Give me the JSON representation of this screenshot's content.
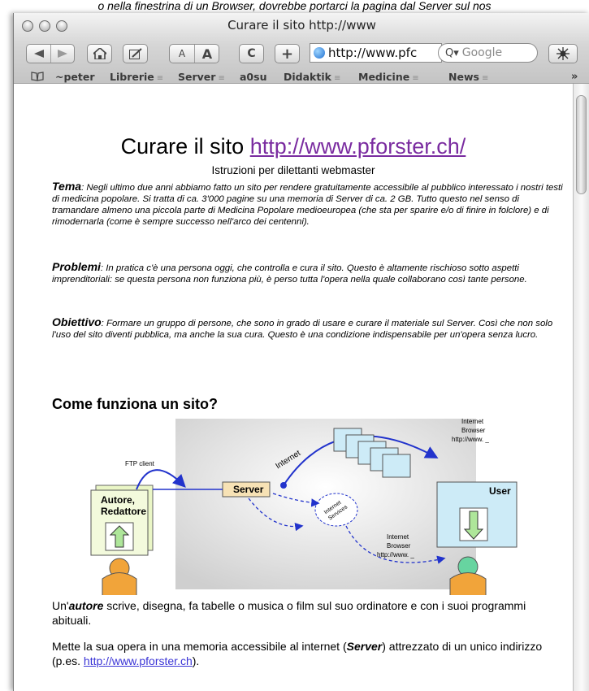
{
  "caption": "o nella finestrina di un Browser, dovrebbe portarci la pagina dal Server sul nos",
  "window": {
    "title": "Curare il sito http://www"
  },
  "toolbar": {
    "text_smaller": "A",
    "text_bigger": "A",
    "reload_glyph": "C",
    "add_glyph": "+",
    "url": "http://www.pfc",
    "search_placeholder": "Google"
  },
  "bookmarks": [
    "~peter",
    "Librerie",
    "Server",
    "a0su",
    "Didaktik",
    "Medicine",
    "News"
  ],
  "page": {
    "title_prefix": "Curare il sito ",
    "title_link": "http://www.pforster.ch/",
    "subtitle": "Istruzioni per dilettanti webmaster",
    "tema_label": "Tema",
    "tema_text": ": Negli ultimo due anni abbiamo fatto un sito per rendere gratuitamente accessibile al pubblico interessato i nostri testi di medicina popolare. Si tratta di ca. 3'000 pagine su una memoria di Server di ca. 2 GB. Tutto questo nel senso di tramandare almeno una piccola parte di Medicina Popolare medioeuropea (che sta per sparire e/o di finire in folclore) e di rimodernarla (come è sempre successo nell'arco dei centenni).",
    "problemi_label": "Problemi",
    "problemi_text": ": In pratica c'è una persona oggi, che controlla e cura il sito. Questo è altamente rischioso sotto aspetti imprenditoriali: se questa persona non funziona più, è perso tutta l'opera nella quale collaborano così tante persone.",
    "obiettivo_label": "Obiettivo",
    "obiettivo_text": ": Formare un gruppo di persone, che sono in grado di usare e curare il materiale sul Server. Così che non solo l'uso del sito diventi pubblica, ma anche la sua cura. Questo è una condizione indispensabile per un'opera senza lucro.",
    "section_heading": "Come funziona un sito?",
    "diagram": {
      "ftp_client": "FTP client",
      "author_line1": "Autore,",
      "author_line2": "Redattore",
      "server": "Server",
      "internet": "Internet",
      "internet_services_1": "Internet",
      "internet_services_2": "Services",
      "browser_top_1": "Internet",
      "browser_top_2": "Browser",
      "browser_top_3": "http://www. _",
      "browser_bottom_1": "Internet",
      "browser_bottom_2": "Browser",
      "browser_bottom_3": "http://www. _",
      "user": "User",
      "colors": {
        "green_box": "#eaf6c6",
        "blue_box": "#cdebf7",
        "server_box": "#f7e2b5",
        "arrow": "#2233cc",
        "head": "#f1a43a"
      }
    },
    "p1_prefix": "Un'",
    "p1_bold": "autore",
    "p1_suffix": " scrive, disegna, fa tabelle o musica o film sul suo ordinatore e con i suoi programmi abituali.",
    "p2_prefix": "Mette la sua opera in una memoria accessibile al internet (",
    "p2_bold": "Server",
    "p2_middle": ") attrezzato di un unico indirizzo (p.es. ",
    "p2_link": "http://www.pforster.ch",
    "p2_suffix": ")."
  }
}
